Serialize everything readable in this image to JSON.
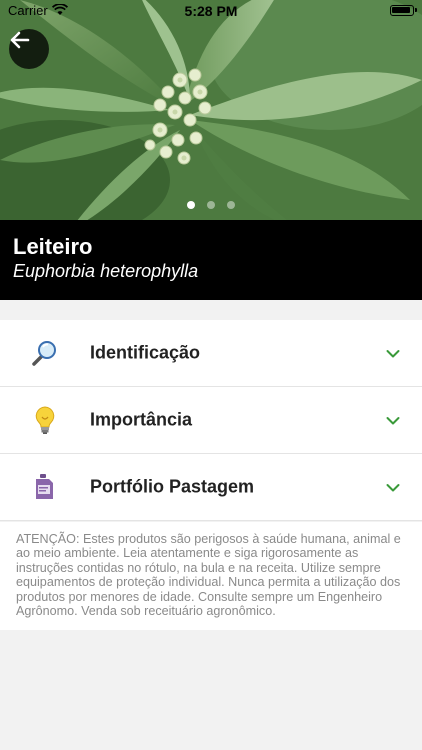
{
  "status_bar": {
    "carrier": "Carrier",
    "time": "5:28 PM"
  },
  "hero": {
    "carousel_total": 3,
    "carousel_active_index": 0
  },
  "plant": {
    "common_name": "Leiteiro",
    "scientific_name": "Euphorbia heterophylla"
  },
  "sections": [
    {
      "label": "Identificação",
      "icon": "magnifier-icon"
    },
    {
      "label": "Importância",
      "icon": "lightbulb-icon"
    },
    {
      "label": "Portfólio Pastagem",
      "icon": "product-jug-icon"
    }
  ],
  "warning": {
    "text": "ATENÇÃO: Estes produtos são perigosos à saúde humana, animal e ao meio ambiente. Leia atentamente e siga rigorosamente as instruções contidas no rótulo, na bula e na receita. Utilize sempre equipamentos de proteção individual. Nunca permita a utilização dos produtos por menores de idade. Consulte sempre um Engenheiro Agrônomo. Venda sob receituário agronômico."
  },
  "colors": {
    "accent_chevron": "#3a9a3a",
    "title_band": "#000000",
    "background": "#f2f2f2"
  }
}
